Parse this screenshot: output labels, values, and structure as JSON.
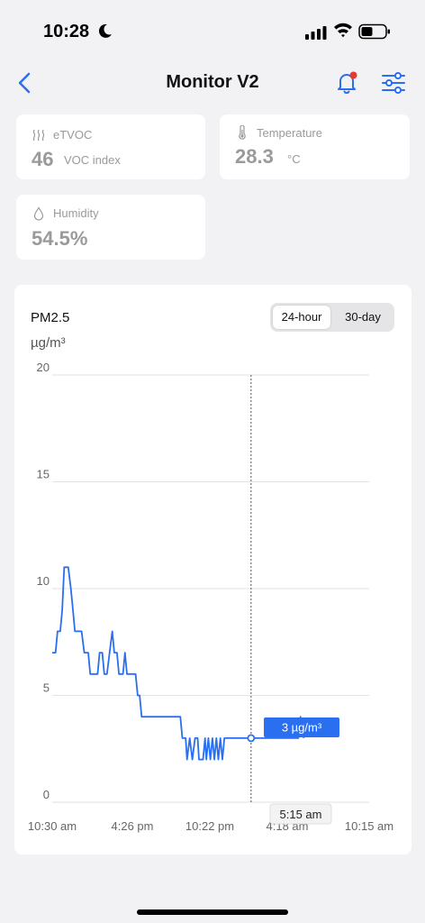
{
  "status": {
    "time": "10:28"
  },
  "nav": {
    "title": "Monitor V2"
  },
  "cards": {
    "etvoc": {
      "label": "eTVOC",
      "value": "46",
      "unit": "VOC index"
    },
    "temperature": {
      "label": "Temperature",
      "value": "28.3",
      "unit": "°C"
    },
    "humidity": {
      "label": "Humidity",
      "value": "54.5%"
    }
  },
  "chart_section": {
    "title": "PM2.5",
    "unit": "µg/m³",
    "range_options": [
      "24-hour",
      "30-day"
    ],
    "selected_range": "24-hour",
    "tooltip_value": "3 µg/m³",
    "tooltip_time": "5:15 am"
  },
  "colors": {
    "accent": "#2a6ff0",
    "alert_dot": "#e5392f"
  },
  "chart_data": {
    "type": "line",
    "title": "PM2.5",
    "ylabel": "µg/m³",
    "ylim": [
      0,
      20
    ],
    "yticks": [
      "0",
      "5",
      "10",
      "15",
      "20"
    ],
    "xticks": [
      "10:30 am",
      "4:26 pm",
      "10:22 pm",
      "4:18 am",
      "10:15 am"
    ],
    "xlim_hours": [
      0,
      23.75
    ],
    "grid": true,
    "series": [
      {
        "values": [
          [
            0,
            7
          ],
          [
            0.25,
            7
          ],
          [
            0.4,
            8
          ],
          [
            0.6,
            8
          ],
          [
            0.75,
            9
          ],
          [
            0.9,
            11
          ],
          [
            1.2,
            11
          ],
          [
            1.4,
            10
          ],
          [
            1.55,
            9
          ],
          [
            1.7,
            8
          ],
          [
            2.2,
            8
          ],
          [
            2.4,
            7
          ],
          [
            2.7,
            7
          ],
          [
            2.85,
            6
          ],
          [
            3.4,
            6
          ],
          [
            3.55,
            7
          ],
          [
            3.75,
            7
          ],
          [
            3.9,
            6
          ],
          [
            4.1,
            6
          ],
          [
            4.3,
            7
          ],
          [
            4.5,
            8
          ],
          [
            4.65,
            7
          ],
          [
            4.85,
            7
          ],
          [
            5.0,
            6
          ],
          [
            5.3,
            6
          ],
          [
            5.45,
            7
          ],
          [
            5.6,
            6
          ],
          [
            6.0,
            6
          ],
          [
            6.25,
            6
          ],
          [
            6.4,
            5
          ],
          [
            6.55,
            5
          ],
          [
            6.7,
            4
          ],
          [
            7.3,
            4
          ],
          [
            7.5,
            4
          ],
          [
            8.6,
            4
          ],
          [
            8.8,
            4
          ],
          [
            9.6,
            4
          ],
          [
            9.75,
            3
          ],
          [
            10.0,
            3
          ],
          [
            10.1,
            2
          ],
          [
            10.3,
            3
          ],
          [
            10.5,
            2
          ],
          [
            10.7,
            3
          ],
          [
            10.9,
            3
          ],
          [
            11.0,
            2
          ],
          [
            11.3,
            2
          ],
          [
            11.45,
            3
          ],
          [
            11.55,
            2
          ],
          [
            11.7,
            3
          ],
          [
            11.85,
            2
          ],
          [
            12.0,
            3
          ],
          [
            12.15,
            2
          ],
          [
            12.3,
            3
          ],
          [
            12.45,
            2
          ],
          [
            12.6,
            3
          ],
          [
            12.75,
            2
          ],
          [
            12.9,
            3
          ],
          [
            13.2,
            3
          ],
          [
            14.2,
            3
          ],
          [
            14.8,
            3
          ],
          [
            15.1,
            3
          ],
          [
            15.25,
            3
          ],
          [
            15.5,
            3
          ],
          [
            16.7,
            3
          ],
          [
            16.9,
            3
          ],
          [
            17.05,
            3
          ],
          [
            17.3,
            3
          ],
          [
            18.2,
            3
          ],
          [
            18.45,
            3
          ],
          [
            18.6,
            4
          ],
          [
            18.85,
            3
          ]
        ]
      }
    ]
  }
}
